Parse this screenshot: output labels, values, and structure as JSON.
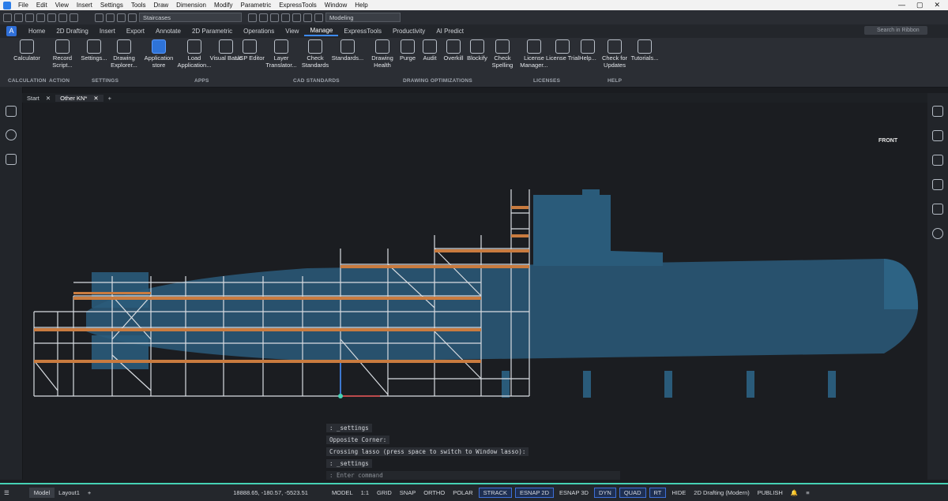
{
  "menubar": {
    "items": [
      "File",
      "Edit",
      "View",
      "Insert",
      "Settings",
      "Tools",
      "Draw",
      "Dimension",
      "Modify",
      "Parametric",
      "ExpressTools",
      "Window",
      "Help"
    ],
    "window_controls": [
      "—",
      "▢",
      "✕"
    ]
  },
  "quick_access": {
    "layer_value": "Staircases",
    "workspace_value": "Modeling"
  },
  "ribbon_tabs": {
    "items": [
      "Home",
      "2D Drafting",
      "Insert",
      "Export",
      "Annotate",
      "2D Parametric",
      "Operations",
      "View",
      "Manage",
      "ExpressTools",
      "Productivity",
      "AI Predict"
    ],
    "active": "Manage",
    "search_placeholder": "Search in Ribbon"
  },
  "ribbon": {
    "buttons": [
      {
        "label": "Calculator",
        "icon": "calculator-icon"
      },
      {
        "label": "Record Script...",
        "icon": "record-script-icon"
      },
      {
        "label": "Settings...",
        "icon": "gear-icon"
      },
      {
        "label": "Drawing Explorer...",
        "icon": "drawing-explorer-icon"
      },
      {
        "label": "Application store",
        "icon": "app-store-icon"
      },
      {
        "label": "Load Application...",
        "icon": "wrench-icon"
      },
      {
        "label": "Visual Basic",
        "icon": "visual-basic-icon"
      },
      {
        "label": "LISP Editor",
        "icon": "lisp-editor-icon"
      },
      {
        "label": "Layer Translator...",
        "icon": "layers-icon"
      },
      {
        "label": "Check Standards",
        "icon": "check-standards-icon"
      },
      {
        "label": "Standards...",
        "icon": "standards-icon"
      },
      {
        "label": "Drawing Health",
        "icon": "drawing-health-icon"
      },
      {
        "label": "Purge",
        "icon": "purge-icon"
      },
      {
        "label": "Audit",
        "icon": "audit-icon"
      },
      {
        "label": "Overkill",
        "icon": "overkill-icon"
      },
      {
        "label": "Blockify",
        "icon": "blockify-icon"
      },
      {
        "label": "Check Spelling",
        "icon": "spelling-icon"
      },
      {
        "label": "License Manager...",
        "icon": "license-manager-icon"
      },
      {
        "label": "License Trial",
        "icon": "license-trial-icon"
      },
      {
        "label": "Help...",
        "icon": "help-icon"
      },
      {
        "label": "Check for Updates",
        "icon": "updates-icon"
      },
      {
        "label": "Tutorials...",
        "icon": "tutorials-icon"
      }
    ],
    "groups": [
      "CALCULATION",
      "ACTION",
      "SETTINGS",
      "APPS",
      "CAD STANDARDS",
      "DRAWING OPTIMIZATIONS",
      "LICENSES",
      "HELP"
    ]
  },
  "document_tabs": {
    "items": [
      {
        "label": "Start",
        "close": "✕"
      },
      {
        "label": "Other KN*",
        "close": "✕"
      }
    ],
    "add": "+"
  },
  "viewcube_label": "FRONT",
  "command_history": [
    ": _settings",
    "Opposite Corner:",
    "Crossing lasso (press space to switch to Window lasso):",
    ": _settings"
  ],
  "command_placeholder": ": Enter command",
  "statusbar": {
    "model_tab": "Model",
    "layout_tab": "Layout1",
    "coordinates": "18888.65, -180.57, -5523.51",
    "space": "MODEL",
    "scale": "1:1",
    "toggles": [
      "GRID",
      "SNAP",
      "ORTHO",
      "POLAR",
      "STRACK",
      "ESNAP 2D",
      "ESNAP 3D",
      "DYN",
      "QUAD",
      "RT",
      "HIDE"
    ],
    "workspace": "2D Drafting (Modern)",
    "publish": "PUBLISH"
  },
  "colors": {
    "hull": "#2a5b7a",
    "scaffold": "#d9dde2",
    "deck": "#c97b3f",
    "accent": "#3d8bff",
    "status_border": "#46d2b4"
  }
}
